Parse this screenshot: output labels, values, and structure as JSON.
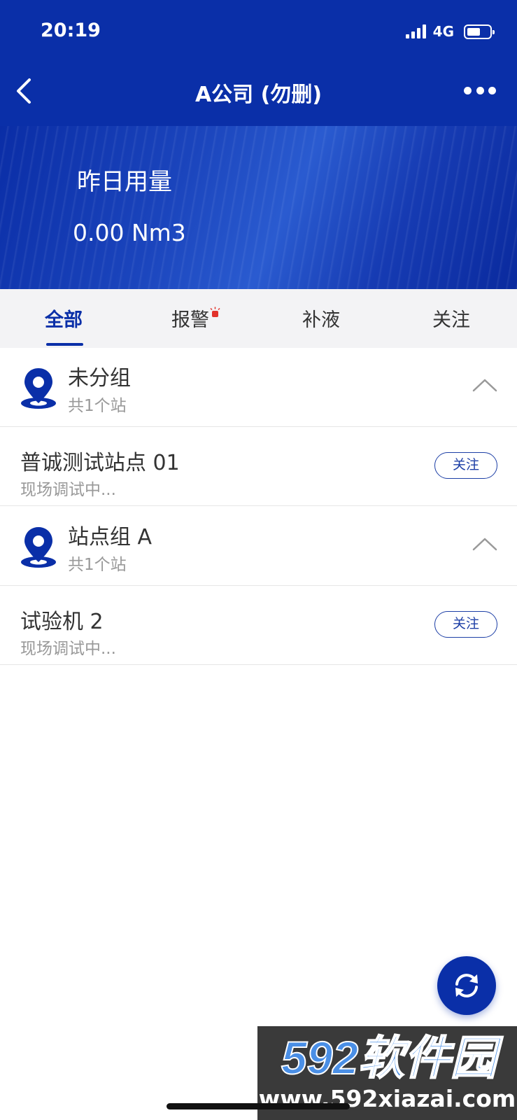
{
  "status_bar": {
    "time": "20:19",
    "network": "4G"
  },
  "nav": {
    "title": "A公司 (勿删)"
  },
  "banner": {
    "label": "昨日用量",
    "value": "0.00 Nm3"
  },
  "tabs": [
    {
      "label": "全部",
      "active": true
    },
    {
      "label": "报警",
      "active": false,
      "badge": true
    },
    {
      "label": "补液",
      "active": false
    },
    {
      "label": "关注",
      "active": false
    }
  ],
  "groups": [
    {
      "name": "未分组",
      "count": "共1个站",
      "stations": [
        {
          "name": "普诚测试站点 01",
          "status": "现场调试中...",
          "follow_label": "关注"
        }
      ]
    },
    {
      "name": "站点组 A",
      "count": "共1个站",
      "stations": [
        {
          "name": "试验机 2",
          "status": "现场调试中...",
          "follow_label": "关注"
        }
      ]
    }
  ],
  "watermark": {
    "logo": "592软件园",
    "url": "www.592xiazai.com"
  },
  "colors": {
    "primary": "#0a2fa8",
    "tab_bg": "#f3f3f5",
    "alarm": "#e2322b",
    "muted_text": "#999999"
  },
  "icons": {
    "back": "chevron-left-icon",
    "more": "more-dots-icon",
    "group": "location-pin-icon",
    "collapse": "chevron-up-icon",
    "refresh": "refresh-icon"
  }
}
